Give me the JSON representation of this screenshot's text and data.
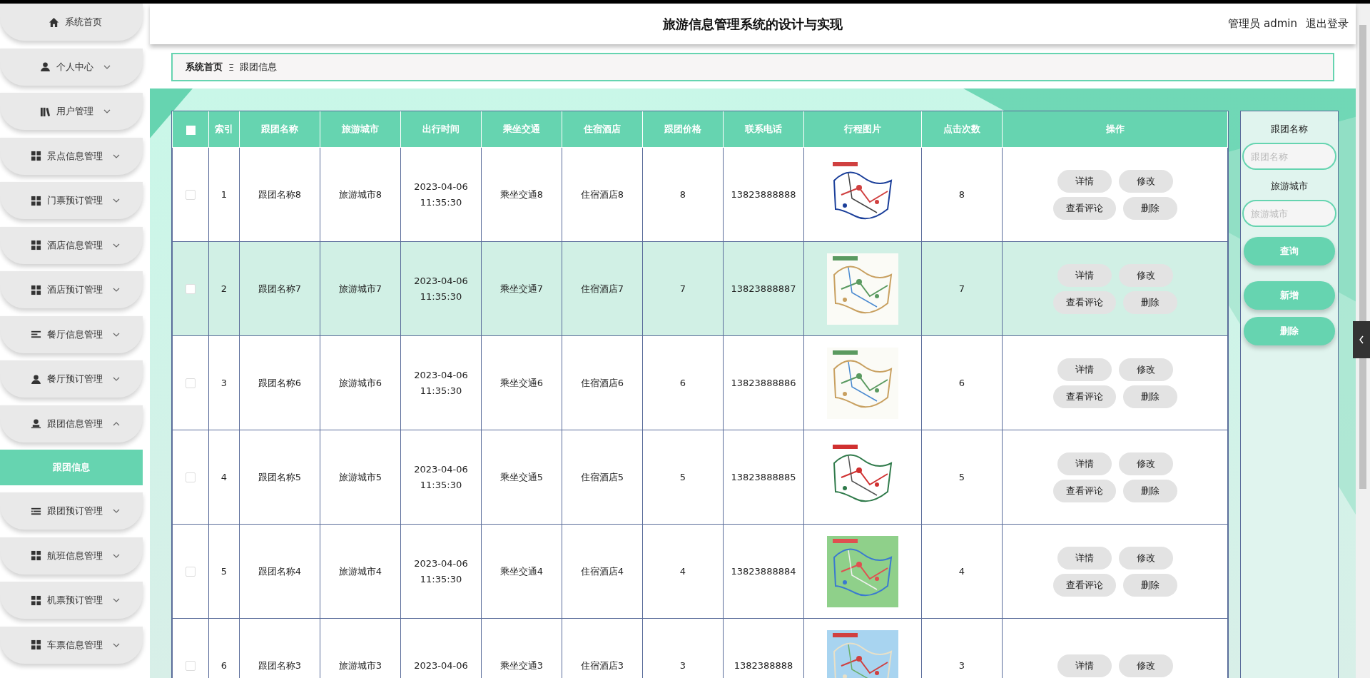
{
  "sidebar": {
    "items": [
      {
        "label": "系统首页",
        "kind": "link"
      },
      {
        "label": "个人中心",
        "kind": "menu",
        "expanded": false
      },
      {
        "label": "用户管理",
        "kind": "menu",
        "expanded": false
      },
      {
        "label": "景点信息管理",
        "kind": "menu",
        "expanded": false
      },
      {
        "label": "门票预订管理",
        "kind": "menu",
        "expanded": false
      },
      {
        "label": "酒店信息管理",
        "kind": "menu",
        "expanded": false
      },
      {
        "label": "酒店预订管理",
        "kind": "menu",
        "expanded": false
      },
      {
        "label": "餐厅信息管理",
        "kind": "menu",
        "expanded": false
      },
      {
        "label": "餐厅预订管理",
        "kind": "menu",
        "expanded": false
      },
      {
        "label": "跟团信息管理",
        "kind": "menu",
        "expanded": true,
        "children": [
          {
            "label": "跟团信息",
            "selected": true
          }
        ]
      },
      {
        "label": "跟团预订管理",
        "kind": "menu",
        "expanded": false
      },
      {
        "label": "航班信息管理",
        "kind": "menu",
        "expanded": false
      },
      {
        "label": "机票预订管理",
        "kind": "menu",
        "expanded": false
      },
      {
        "label": "车票信息管理",
        "kind": "menu",
        "expanded": false
      }
    ]
  },
  "header": {
    "title": "旅游信息管理系统的设计与实现",
    "user": "管理员 admin",
    "logout": "退出登录"
  },
  "breadcrumb": {
    "items": [
      "系统首页",
      "跟团信息"
    ],
    "separator": "Ξ"
  },
  "table": {
    "all_checked": false,
    "columns": [
      "索引",
      "跟团名称",
      "旅游城市",
      "出行时间",
      "乘坐交通",
      "住宿酒店",
      "跟团价格",
      "联系电话",
      "行程图片",
      "点击次数",
      "操作"
    ],
    "rows": [
      {
        "checked": false,
        "highlighted": false,
        "cells": [
          "1",
          "跟团名称8",
          "旅游城市8",
          "2023-04-06 11:35:30",
          "乘坐交通8",
          "住宿酒店8",
          "8",
          "13823888888",
          "8"
        ],
        "actions": [
          "详情",
          "修改",
          "查看评论",
          "删除"
        ]
      },
      {
        "checked": false,
        "highlighted": true,
        "cells": [
          "2",
          "跟团名称7",
          "旅游城市7",
          "2023-04-06 11:35:30",
          "乘坐交通7",
          "住宿酒店7",
          "7",
          "13823888887",
          "7"
        ],
        "actions": [
          "详情",
          "修改",
          "查看评论",
          "删除"
        ]
      },
      {
        "checked": false,
        "highlighted": false,
        "cells": [
          "3",
          "跟团名称6",
          "旅游城市6",
          "2023-04-06 11:35:30",
          "乘坐交通6",
          "住宿酒店6",
          "6",
          "13823888886",
          "6"
        ],
        "actions": [
          "详情",
          "修改",
          "查看评论",
          "删除"
        ]
      },
      {
        "checked": false,
        "highlighted": false,
        "cells": [
          "4",
          "跟团名称5",
          "旅游城市5",
          "2023-04-06 11:35:30",
          "乘坐交通5",
          "住宿酒店5",
          "5",
          "13823888885",
          "5"
        ],
        "actions": [
          "详情",
          "修改",
          "查看评论",
          "删除"
        ]
      },
      {
        "checked": false,
        "highlighted": false,
        "cells": [
          "5",
          "跟团名称4",
          "旅游城市4",
          "2023-04-06 11:35:30",
          "乘坐交通4",
          "住宿酒店4",
          "4",
          "13823888884",
          "4"
        ],
        "actions": [
          "详情",
          "修改",
          "查看评论",
          "删除"
        ]
      },
      {
        "checked": false,
        "highlighted": false,
        "cells": [
          "6",
          "跟团名称3",
          "旅游城市3",
          "2023-04-06",
          "乘坐交通3",
          "住宿酒店3",
          "3",
          "1382388888",
          "3"
        ],
        "actions": [
          "详情",
          "修改"
        ]
      }
    ]
  },
  "search_panel": {
    "fields": [
      {
        "label": "跟团名称",
        "placeholder": "跟团名称"
      },
      {
        "label": "旅游城市",
        "placeholder": "旅游城市"
      }
    ],
    "search_button": "查询",
    "add_button": "新增",
    "delete_button": "删除"
  }
}
